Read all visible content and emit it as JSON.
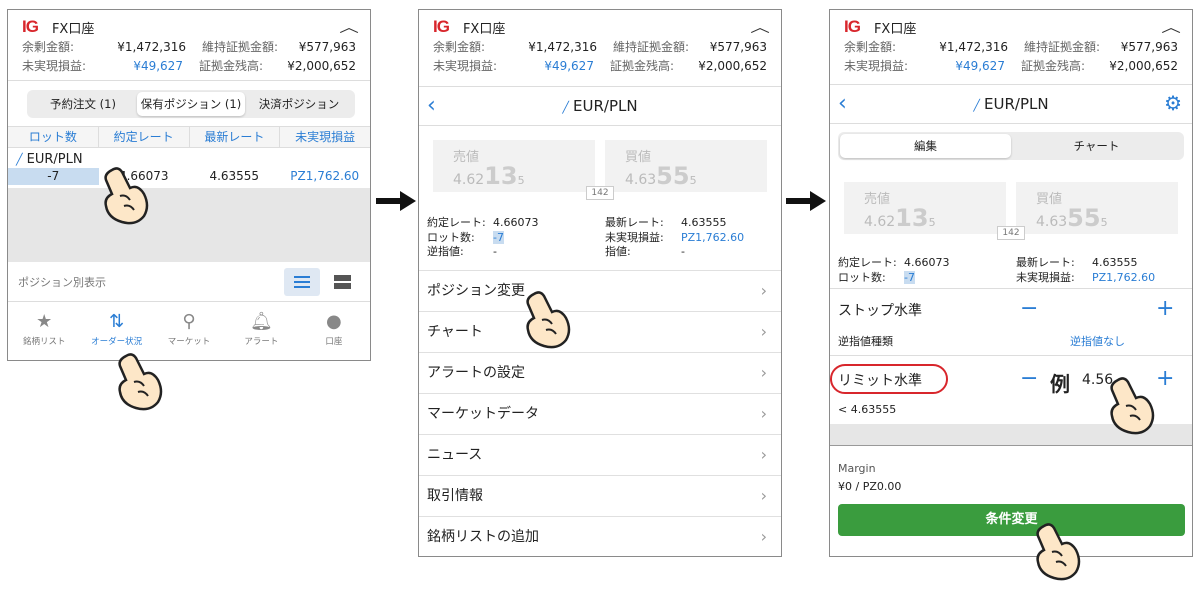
{
  "account": {
    "logo": "IG",
    "title": "FX口座",
    "free_margin_label": "余剰金額:",
    "free_margin": "¥1,472,316",
    "maint_margin_label": "維持証拠金額:",
    "maint_margin": "¥577,963",
    "unrealized_label": "未実現損益:",
    "unrealized": "¥49,627",
    "balance_label": "証拠金残高:",
    "balance": "¥2,000,652"
  },
  "panel1": {
    "segments": [
      "予約注文 (1)",
      "保有ポジション (1)",
      "決済ポジション"
    ],
    "columns": [
      "ロット数",
      "約定レート",
      "最新レート",
      "未実現損益"
    ],
    "pair": "EUR/PLN",
    "row": [
      "-7",
      "4.66073",
      "4.63555",
      "PZ1,762.60"
    ],
    "view_label": "ポジション別表示",
    "tabs": [
      {
        "label": "銘柄リスト",
        "icon": "star-icon"
      },
      {
        "label": "オーダー状況",
        "icon": "order-status-icon"
      },
      {
        "label": "マーケット",
        "icon": "search-icon"
      },
      {
        "label": "アラート",
        "icon": "bell-icon"
      },
      {
        "label": "口座",
        "icon": "account-icon"
      }
    ]
  },
  "detail": {
    "pair": "EUR/PLN",
    "sell_label": "売値",
    "sell_prefix": "4.62",
    "sell_big": "13",
    "sell_small": "5",
    "buy_label": "買値",
    "buy_prefix": "4.63",
    "buy_big": "55",
    "buy_small": "5",
    "spread": "142",
    "rate_label": "約定レート:",
    "rate": "4.66073",
    "lot_label": "ロット数:",
    "lot": "-7",
    "stop_label": "逆指値:",
    "stop": "-",
    "latest_label": "最新レート:",
    "latest": "4.63555",
    "pl_label": "未実現損益:",
    "pl": "PZ1,762.60",
    "limit_label": "指値:",
    "limit": "-"
  },
  "panel2": {
    "menu": [
      "ポジション変更",
      "チャート",
      "アラートの設定",
      "マーケットデータ",
      "ニュース",
      "取引情報",
      "銘柄リストの追加"
    ]
  },
  "panel3": {
    "segments": [
      "編集",
      "チャート"
    ],
    "stop_level": "ストップ水準",
    "stop_type_label": "逆指値種類",
    "stop_type_value": "逆指値なし",
    "limit_level": "リミット水準",
    "example_label": "例",
    "example_value": "4.56",
    "limit_hint": "< 4.63555",
    "margin_label": "Margin",
    "margin_value": "¥0 / PZ0.00",
    "submit": "条件変更"
  },
  "colors": {
    "accent": "#2a7dd4",
    "brand": "#d8262c",
    "submit": "#3a9c3e"
  }
}
